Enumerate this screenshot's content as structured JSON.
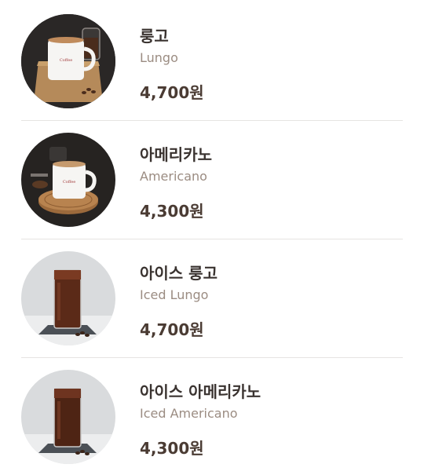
{
  "menu": {
    "items": [
      {
        "name_ko": "룽고",
        "name_en": "Lungo",
        "price": "4,700원",
        "image": "hot-mug-on-wooden-board"
      },
      {
        "name_ko": "아메리카노",
        "name_en": "Americano",
        "price": "4,300원",
        "image": "hot-mug-on-wooden-coaster"
      },
      {
        "name_ko": "아이스 룽고",
        "name_en": "Iced Lungo",
        "price": "4,700원",
        "image": "iced-coffee-glass"
      },
      {
        "name_ko": "아이스 아메리카노",
        "name_en": "Iced Americano",
        "price": "4,300원",
        "image": "iced-coffee-glass"
      }
    ]
  },
  "colors": {
    "name": "#3a3330",
    "subtitle": "#9b8c82",
    "price": "#4a3b33",
    "divider": "#e6e4e2"
  }
}
